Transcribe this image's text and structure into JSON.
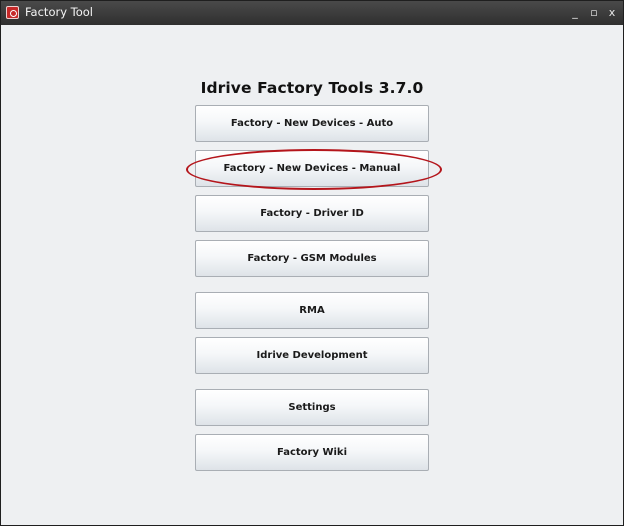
{
  "window": {
    "title": "Factory Tool",
    "controls": {
      "minimize": "_",
      "maximize": "▫",
      "close": "x"
    }
  },
  "main": {
    "heading": "Idrive Factory Tools 3.7.0",
    "buttons": [
      {
        "label": "Factory - New Devices - Auto"
      },
      {
        "label": "Factory - New Devices - Manual",
        "highlighted": true
      },
      {
        "label": "Factory - Driver ID"
      },
      {
        "label": "Factory - GSM Modules"
      },
      {
        "label": "RMA"
      },
      {
        "label": "Idrive Development"
      },
      {
        "label": "Settings"
      },
      {
        "label": "Factory Wiki"
      }
    ]
  },
  "colors": {
    "titlebar": "#3a3a3a",
    "background": "#eef0f2",
    "highlight_ring": "#b4151b"
  },
  "icons": {
    "app": "app-logo-icon"
  }
}
